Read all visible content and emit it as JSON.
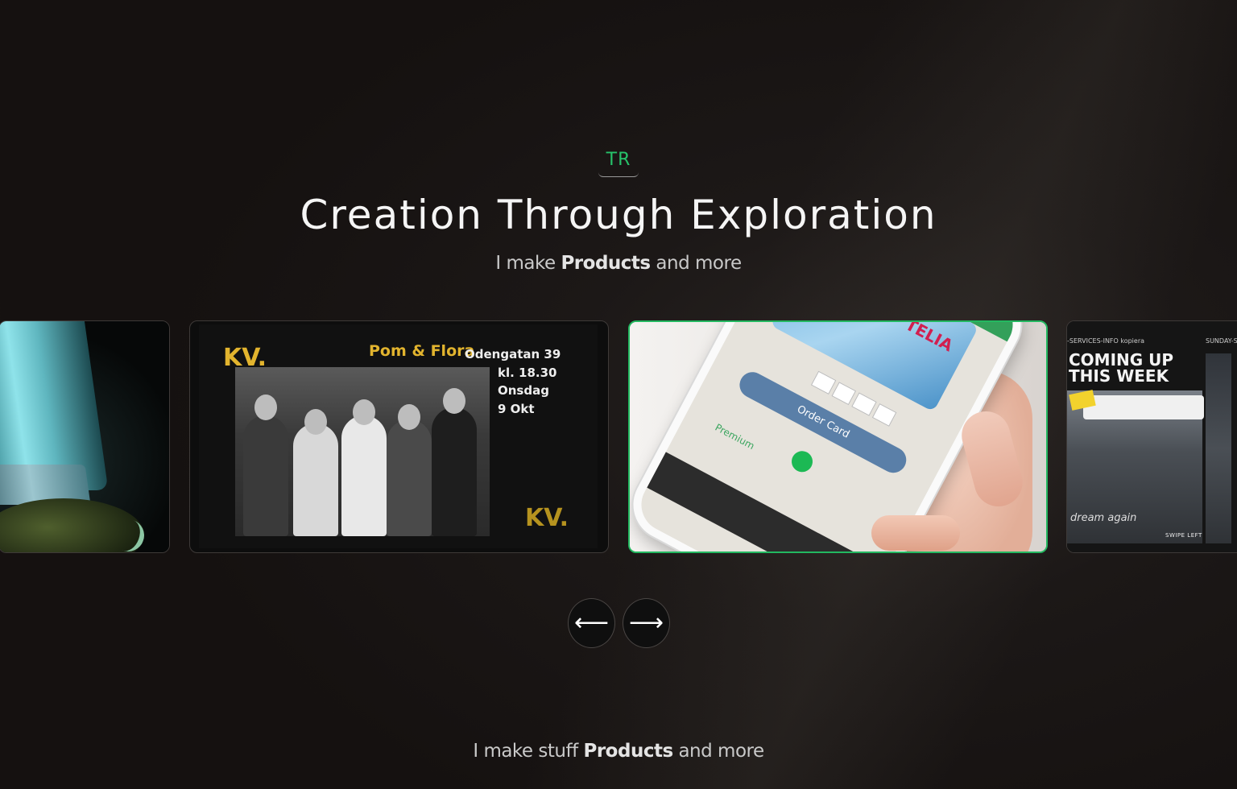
{
  "logo": {
    "text": "TR"
  },
  "hero": {
    "title": "Creation Through Exploration",
    "subtitle_pre": "I make ",
    "subtitle_bold": "Products",
    "subtitle_post": " and more"
  },
  "carousel": {
    "cards": [
      {
        "kind": "artwork"
      },
      {
        "kind": "poster",
        "brand": "KV.",
        "band": "Pom & Flora",
        "address": "Odengatan 39",
        "time": "kl. 18.30",
        "day": "Onsdag",
        "date": "9 Okt"
      },
      {
        "kind": "phone-app",
        "telia": "TELIA",
        "order_label": "Order Card",
        "premium_label": "Premium"
      },
      {
        "kind": "event-page",
        "header_left": "-SERVICES-INFO kopiera",
        "header_right": "SUNDAY-SER",
        "headline": "COMING UP THIS WEEK",
        "script": "dream again",
        "swipe": "SWIPE LEFT"
      }
    ],
    "prev_label": "⟵",
    "next_label": "⟶"
  },
  "footer": {
    "pre": "I make stuff ",
    "bold": "Products",
    "post": " and more"
  },
  "colors": {
    "accent": "#27c26a",
    "active_border": "#23b860",
    "background": "#1c1817"
  }
}
